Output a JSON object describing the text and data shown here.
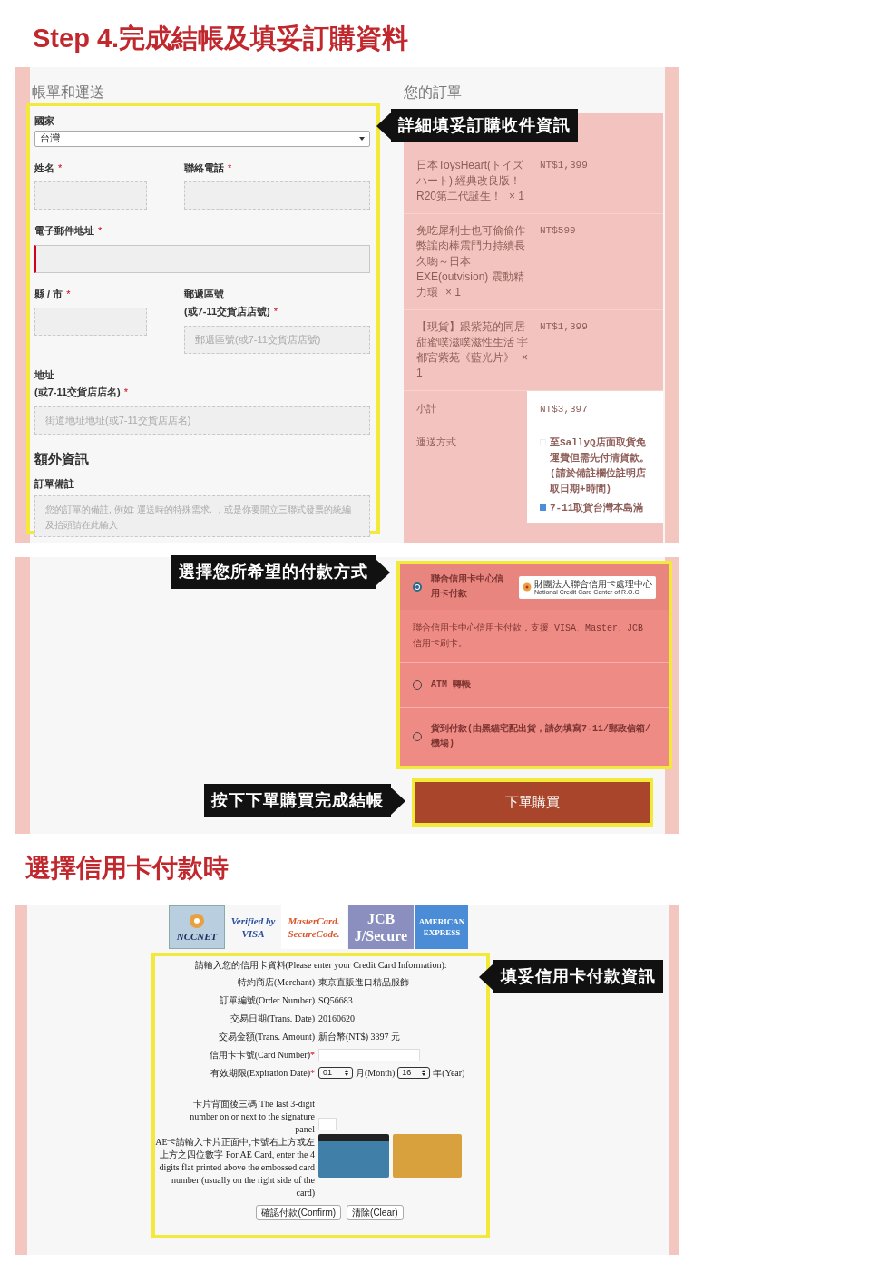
{
  "step_title": "Step 4.完成結帳及填妥訂購資料",
  "checkout": {
    "billing_heading": "帳單和運送",
    "order_heading": "您的訂單",
    "callout": "詳細填妥訂購收件資訊",
    "rows": [
      [
        {
          "label": "國家",
          "kind": "select",
          "value": "台灣"
        }
      ],
      [
        {
          "label": "姓名",
          "required_mark": "*",
          "kind": "input"
        },
        {
          "label": "聯絡電話",
          "required_mark": "*",
          "kind": "input"
        }
      ],
      [
        {
          "label": "電子郵件地址",
          "required_mark": "*",
          "kind": "input",
          "focused": true
        }
      ],
      [
        {
          "label": "縣 / 市",
          "required_mark": "*",
          "kind": "input"
        },
        {
          "label": "郵遞區號",
          "note": "(或7-11交貨店店號)",
          "required_mark": "*",
          "kind": "input",
          "placeholder": "郵遞區號(或7-11交貨店店號)"
        }
      ],
      [
        {
          "label": "地址",
          "note": "(或7-11交貨店店名)",
          "required_mark": "*",
          "kind": "input",
          "placeholder": "街道地址地址(或7-11交貨店店名)"
        }
      ]
    ],
    "extra_heading": "額外資訊",
    "notes_label": "訂單備註",
    "notes_placeholder": "您的訂單的備註, 例如: 運送時的特殊需求. ，或是你要開立三聯式發票的統編及抬頭請在此輸入",
    "items": [
      {
        "name": "日本ToysHeart(トイズハート) 經典改良版！R20第二代誕生！",
        "qty": "× 1",
        "price": "NT$1,399"
      },
      {
        "name": "免吃犀利士也可偷偷作弊讓肉棒震鬥力持續長久喲～日本EXE(outvision) 震動精力環",
        "qty": "× 1",
        "price": "NT$599"
      },
      {
        "name": "【現貨】跟紫苑的同居甜蜜噗滋噗滋性生活 宇都宮紫苑《藍光片》",
        "qty": "× 1",
        "price": "NT$1,399"
      }
    ],
    "subtotal_label": "小計",
    "subtotal": "NT$3,397",
    "shipping_label": "運送方式",
    "shipping_options": [
      {
        "label": "至SallyQ店面取貨免運費但需先付清貨款。(請於備註欄位註明店取日期+時間)",
        "selected": false
      },
      {
        "label": "7-11取貨台灣本島滿",
        "selected": true
      }
    ]
  },
  "payment": {
    "callout": "選擇您所希望的付款方式",
    "methods": [
      {
        "label": "聯合信用卡中心信用卡付款",
        "selected": true,
        "logo_lines": [
          "財團法人聯合信用卡處理中心",
          "National Credit Card Center of R.O.C."
        ],
        "description": "聯合信用卡中心信用卡付款，支援 VISA、Master、JCB 信用卡刷卡。"
      },
      {
        "label": "ATM 轉帳",
        "selected": false
      },
      {
        "label": "貨到付款(由黑貓宅配出貨，請勿填寫7-11/郵政信箱/機場)",
        "selected": false
      }
    ],
    "order_callout": "按下下單購買完成結帳",
    "order_button": "下單購買"
  },
  "card_title": "選擇信用卡付款時",
  "card_form": {
    "callout": "填妥信用卡付款資訊",
    "logos": [
      {
        "kind": "nccnet",
        "lines": [
          "NCCNET"
        ]
      },
      {
        "kind": "visa",
        "lines": [
          "Verified by",
          "VISA"
        ]
      },
      {
        "kind": "mastercard",
        "lines": [
          "MasterCard.",
          "SecureCode."
        ]
      },
      {
        "kind": "jcb",
        "lines": [
          "JCB",
          "J/Secure"
        ]
      },
      {
        "kind": "amex",
        "lines": [
          "AMERICAN",
          "EXPRESS"
        ]
      }
    ],
    "intro": "請輸入您的信用卡資料(Please enter your Credit Card Information):",
    "info_rows": [
      {
        "label": "特約商店(Merchant)",
        "value": "東京直販進口精品服飾"
      },
      {
        "label": "訂單編號(Order Number)",
        "value": "SQ56683"
      },
      {
        "label": "交易日期(Trans. Date)",
        "value": "20160620"
      },
      {
        "label": "交易金額(Trans. Amount)",
        "value": "新台幣(NT$) 3397 元"
      }
    ],
    "card_number_label": "信用卡卡號(Card Number)",
    "required_mark": "*",
    "expiry_label": "有效期限(Expiration Date)",
    "month": "01",
    "month_label": "月(Month)",
    "year": "16",
    "year_label": "年(Year)",
    "cvv_label": "卡片背面後三碼 The last 3-digit number on or next to the signature panel",
    "ae_note": "AE卡請輸入卡片正面中,卡號右上方或左上方之四位數字 For AE Card, enter the 4 digits flat printed above the embossed card number (usually on the right side of the card)",
    "buttons": [
      "確認付款(Confirm)",
      "清除(Clear)"
    ]
  }
}
